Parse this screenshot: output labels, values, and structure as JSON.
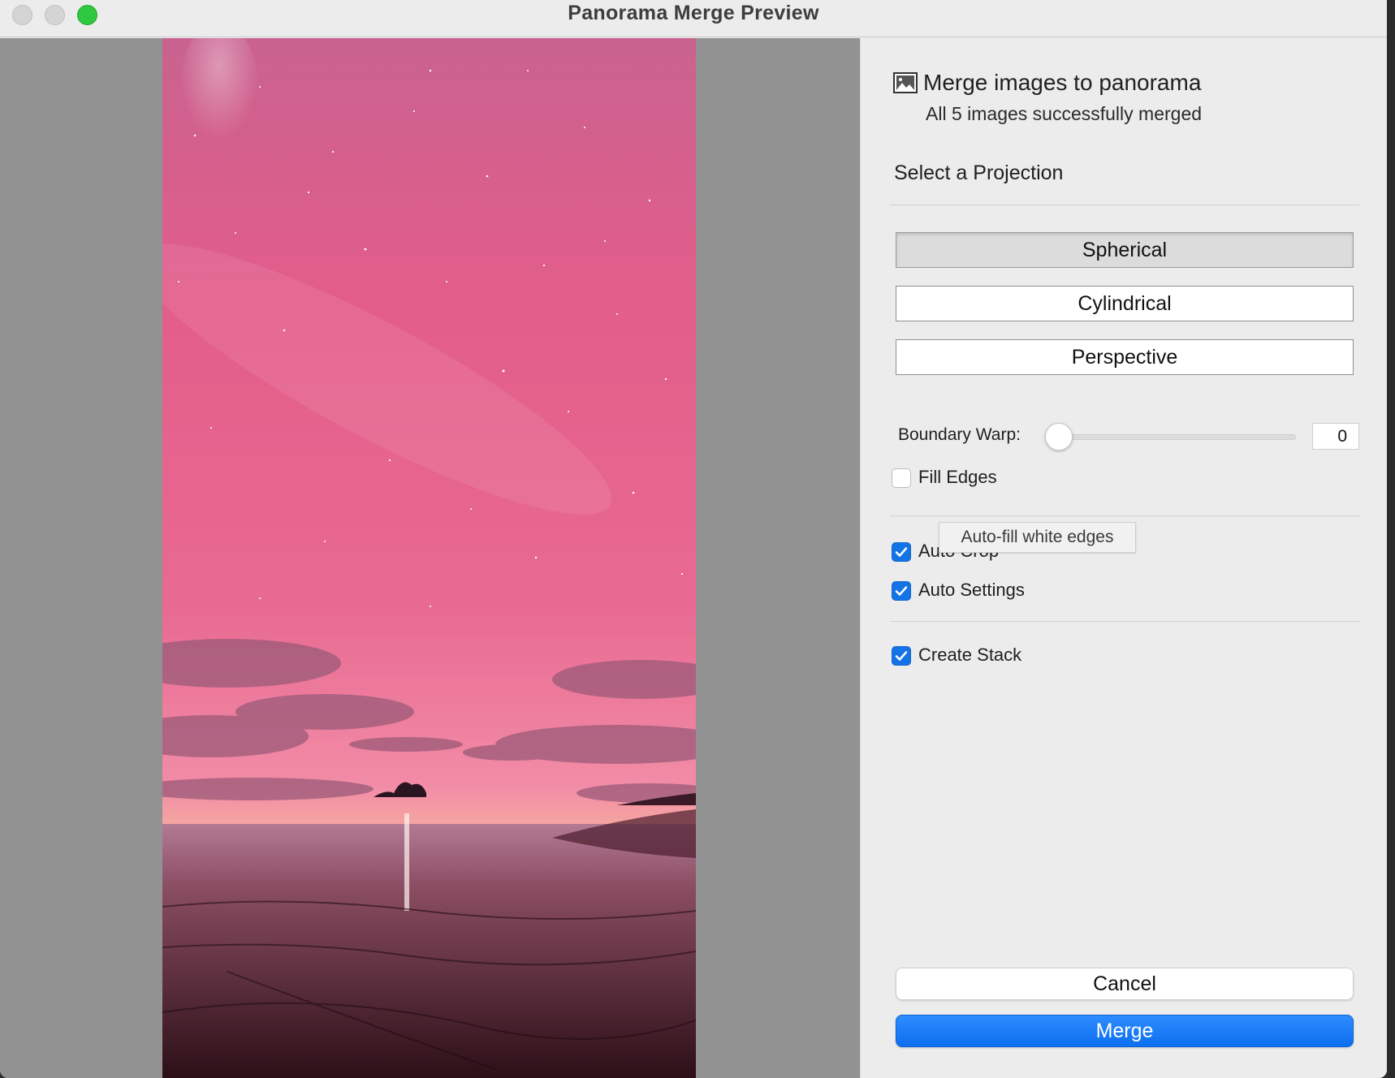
{
  "window": {
    "title": "Panorama Merge Preview"
  },
  "panel": {
    "header_title": "Merge images to panorama",
    "header_subtitle": "All 5 images successfully merged",
    "projection_label": "Select a Projection",
    "projections": [
      {
        "label": "Spherical",
        "selected": true
      },
      {
        "label": "Cylindrical",
        "selected": false
      },
      {
        "label": "Perspective",
        "selected": false
      }
    ],
    "boundary_warp": {
      "label": "Boundary Warp:",
      "value": "0"
    },
    "fill_edges": {
      "label": "Fill Edges",
      "checked": false
    },
    "tooltip": "Auto-fill white edges",
    "auto_crop": {
      "label": "Auto Crop",
      "checked": true
    },
    "auto_settings": {
      "label": "Auto Settings",
      "checked": true
    },
    "create_stack": {
      "label": "Create Stack",
      "checked": true
    },
    "cancel_label": "Cancel",
    "merge_label": "Merge"
  },
  "colors": {
    "accent": "#1473e6",
    "merge_button": "#0d6ff0",
    "preview_bg": "#929292",
    "panel_bg": "#ececec"
  },
  "icons": {
    "header": "image-icon",
    "checkbox": "checkmark-icon"
  }
}
